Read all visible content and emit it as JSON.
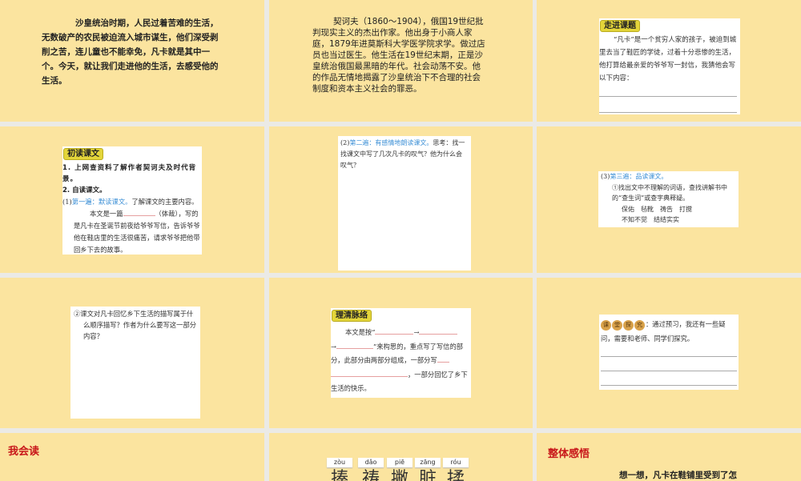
{
  "slides": {
    "s1": {
      "text": "沙皇统治时期，人民过着苦难的生活，无数破产的农民被迫流入城市谋生，他们深受剥削之苦，连儿童也不能幸免，凡卡就是其中一个。今天，就让我们走进他的生活，去感受他的生活。"
    },
    "s2": {
      "text": "契诃夫（1860～1904），俄国19世纪批判现实主义的杰出作家。他出身于小商人家庭，1879年进莫斯科大学医学院求学。做过店员也当过医生。他生活在19世纪末期，正是沙皇统治俄国最黑暗的年代。社会动荡不安。他的作品无情地揭露了沙皇统治下不合理的社会制度和资本主义社会的罪恶。"
    },
    "s3": {
      "tag": "走进课题",
      "text": "“凡卡”是一个贫穷人家的孩子，被迫到城里去当了鞋匠的学徒，过着十分悲惨的生活，他打算给最亲爱的爷爷写一封信，我猜他会写以下内容："
    },
    "s4": {
      "tag": "初读课文",
      "item1": "1. 上网查资料了解作者契诃夫及时代背景。",
      "item2": "2. 自读课文。",
      "sub_prefix": "(1)",
      "sub_blue": "第一遍：默读课文。",
      "sub_rest": "了解课文的主要内容。",
      "para_a": "本文是一篇",
      "para_b": "（体裁），写的是凡卡在圣诞节前夜给爷爷写信，告诉爷爷他在鞋店里的生活很痛苦，请求爷爷把他带回乡下去的故事。"
    },
    "s5": {
      "prefix": "(2)",
      "blue": "第二遍：有感情地朗读课文。",
      "rest": "思考：找一找课文中写了几次凡卡的叹气？他为什么会叹气？"
    },
    "s6": {
      "prefix": "(3)",
      "blue": "第三遍：品读课文。",
      "q": "①找出文中不理解的词语，查找讲解书中的“查生词”或查字典释疑。",
      "words1": "保佑　毡靴　祷告　打搅",
      "words2": "不知不觉　结结实实"
    },
    "s7": {
      "q": "②课文对凡卡回忆乡下生活的描写属于什么顺序描写？作者为什么要写这一部分内容？"
    },
    "s8": {
      "tag": "理清脉络",
      "a": "本文是按“",
      "arrow": "→",
      "b": "”来构思的，重点写了写信的部分，此部分由两部分组成，一部分写",
      "c": "，一部分回忆了乡下生活的快乐。"
    },
    "s9": {
      "badge": [
        "课",
        "堂",
        "探",
        "究"
      ],
      "text": "：通过预习，我还有一些疑问，需要和老师、同学们探究。"
    },
    "s10": {
      "title": "我会读"
    },
    "s11": {
      "pinyin": [
        "zòu",
        "dǎo",
        "piē",
        "zāng",
        "róu"
      ],
      "chars": [
        "揍",
        "祷",
        "撇",
        "脏",
        "揉"
      ]
    },
    "s12": {
      "title": "整体感悟",
      "text": "想一想，凡卡在鞋铺里受到了怎"
    }
  }
}
